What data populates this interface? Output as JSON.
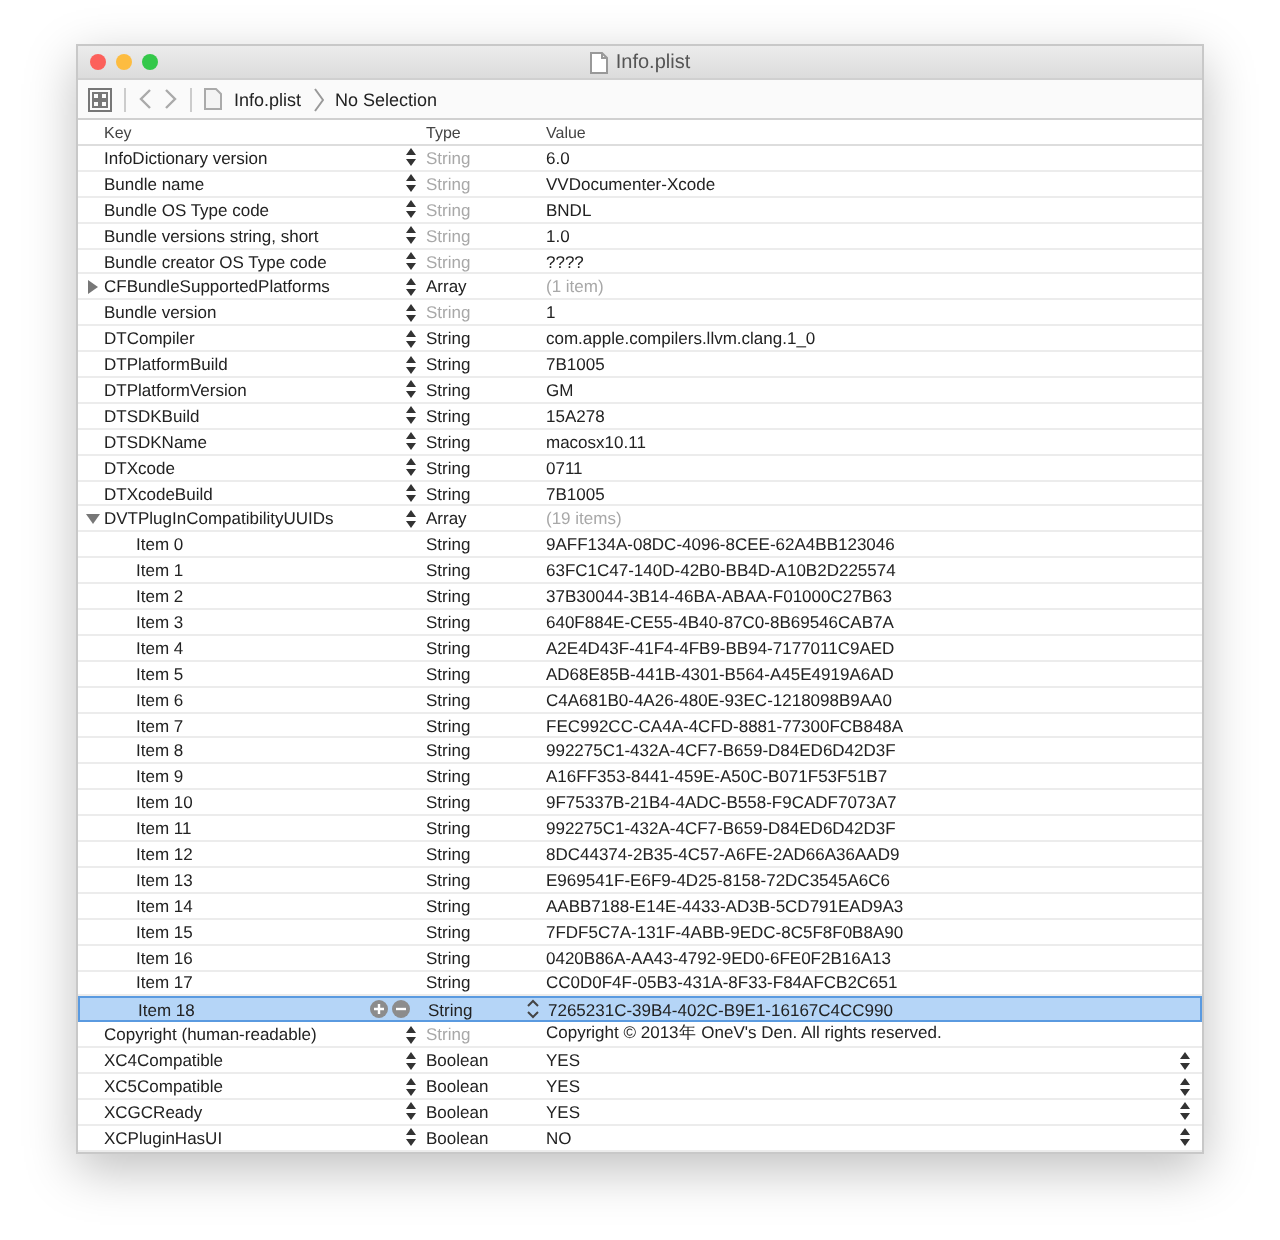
{
  "window": {
    "title": "Info.plist"
  },
  "breadcrumb": [
    "Info.plist",
    "No Selection"
  ],
  "columns": [
    "Key",
    "Type",
    "Value"
  ],
  "rows": [
    {
      "key": "InfoDictionary version",
      "type": "String",
      "type_dimmed": true,
      "value": "6.0",
      "kind": "text",
      "selected": false
    },
    {
      "key": "Bundle name",
      "type": "String",
      "type_dimmed": true,
      "value": "VVDocumenter-Xcode",
      "kind": "text",
      "selected": false
    },
    {
      "key": "Bundle OS Type code",
      "type": "String",
      "type_dimmed": true,
      "value": "BNDL",
      "kind": "text",
      "selected": false
    },
    {
      "key": "Bundle versions string, short",
      "type": "String",
      "type_dimmed": true,
      "value": "1.0",
      "kind": "text",
      "selected": false
    },
    {
      "key": "Bundle creator OS Type code",
      "type": "String",
      "type_dimmed": true,
      "value": "????",
      "kind": "text",
      "selected": false
    },
    {
      "key": "CFBundleSupportedPlatforms",
      "type": "Array",
      "type_dimmed": false,
      "value": "(1 item)",
      "kind": "array",
      "expanded": false,
      "selected": false
    },
    {
      "key": "Bundle version",
      "type": "String",
      "type_dimmed": true,
      "value": "1",
      "kind": "text",
      "selected": false
    },
    {
      "key": "DTCompiler",
      "type": "String",
      "type_dimmed": false,
      "value": "com.apple.compilers.llvm.clang.1_0",
      "kind": "text",
      "selected": false
    },
    {
      "key": "DTPlatformBuild",
      "type": "String",
      "type_dimmed": false,
      "value": "7B1005",
      "kind": "text",
      "selected": false
    },
    {
      "key": "DTPlatformVersion",
      "type": "String",
      "type_dimmed": false,
      "value": "GM",
      "kind": "text",
      "selected": false
    },
    {
      "key": "DTSDKBuild",
      "type": "String",
      "type_dimmed": false,
      "value": "15A278",
      "kind": "text",
      "selected": false
    },
    {
      "key": "DTSDKName",
      "type": "String",
      "type_dimmed": false,
      "value": "macosx10.11",
      "kind": "text",
      "selected": false
    },
    {
      "key": "DTXcode",
      "type": "String",
      "type_dimmed": false,
      "value": "0711",
      "kind": "text",
      "selected": false
    },
    {
      "key": "DTXcodeBuild",
      "type": "String",
      "type_dimmed": false,
      "value": "7B1005",
      "kind": "text",
      "selected": false
    },
    {
      "key": "DVTPlugInCompatibilityUUIDs",
      "type": "Array",
      "type_dimmed": false,
      "value": "(19 items)",
      "kind": "array",
      "expanded": true,
      "selected": false,
      "children": [
        {
          "key": "Item 0",
          "type": "String",
          "type_dimmed": false,
          "value": "9AFF134A-08DC-4096-8CEE-62A4BB123046",
          "kind": "text",
          "selected": false
        },
        {
          "key": "Item 1",
          "type": "String",
          "type_dimmed": false,
          "value": "63FC1C47-140D-42B0-BB4D-A10B2D225574",
          "kind": "text",
          "selected": false
        },
        {
          "key": "Item 2",
          "type": "String",
          "type_dimmed": false,
          "value": "37B30044-3B14-46BA-ABAA-F01000C27B63",
          "kind": "text",
          "selected": false
        },
        {
          "key": "Item 3",
          "type": "String",
          "type_dimmed": false,
          "value": "640F884E-CE55-4B40-87C0-8B69546CAB7A",
          "kind": "text",
          "selected": false
        },
        {
          "key": "Item 4",
          "type": "String",
          "type_dimmed": false,
          "value": "A2E4D43F-41F4-4FB9-BB94-7177011C9AED",
          "kind": "text",
          "selected": false
        },
        {
          "key": "Item 5",
          "type": "String",
          "type_dimmed": false,
          "value": "AD68E85B-441B-4301-B564-A45E4919A6AD",
          "kind": "text",
          "selected": false
        },
        {
          "key": "Item 6",
          "type": "String",
          "type_dimmed": false,
          "value": "C4A681B0-4A26-480E-93EC-1218098B9AA0",
          "kind": "text",
          "selected": false
        },
        {
          "key": "Item 7",
          "type": "String",
          "type_dimmed": false,
          "value": "FEC992CC-CA4A-4CFD-8881-77300FCB848A",
          "kind": "text",
          "selected": false
        },
        {
          "key": "Item 8",
          "type": "String",
          "type_dimmed": false,
          "value": "992275C1-432A-4CF7-B659-D84ED6D42D3F",
          "kind": "text",
          "selected": false
        },
        {
          "key": "Item 9",
          "type": "String",
          "type_dimmed": false,
          "value": "A16FF353-8441-459E-A50C-B071F53F51B7",
          "kind": "text",
          "selected": false
        },
        {
          "key": "Item 10",
          "type": "String",
          "type_dimmed": false,
          "value": "9F75337B-21B4-4ADC-B558-F9CADF7073A7",
          "kind": "text",
          "selected": false
        },
        {
          "key": "Item 11",
          "type": "String",
          "type_dimmed": false,
          "value": "992275C1-432A-4CF7-B659-D84ED6D42D3F",
          "kind": "text",
          "selected": false
        },
        {
          "key": "Item 12",
          "type": "String",
          "type_dimmed": false,
          "value": "8DC44374-2B35-4C57-A6FE-2AD66A36AAD9",
          "kind": "text",
          "selected": false
        },
        {
          "key": "Item 13",
          "type": "String",
          "type_dimmed": false,
          "value": "E969541F-E6F9-4D25-8158-72DC3545A6C6",
          "kind": "text",
          "selected": false
        },
        {
          "key": "Item 14",
          "type": "String",
          "type_dimmed": false,
          "value": "AABB7188-E14E-4433-AD3B-5CD791EAD9A3",
          "kind": "text",
          "selected": false
        },
        {
          "key": "Item 15",
          "type": "String",
          "type_dimmed": false,
          "value": "7FDF5C7A-131F-4ABB-9EDC-8C5F8F0B8A90",
          "kind": "text",
          "selected": false
        },
        {
          "key": "Item 16",
          "type": "String",
          "type_dimmed": false,
          "value": "0420B86A-AA43-4792-9ED0-6FE0F2B16A13",
          "kind": "text",
          "selected": false
        },
        {
          "key": "Item 17",
          "type": "String",
          "type_dimmed": false,
          "value": "CC0D0F4F-05B3-431A-8F33-F84AFCB2C651",
          "kind": "text",
          "selected": false
        },
        {
          "key": "Item 18",
          "type": "String",
          "type_dimmed": false,
          "value": "7265231C-39B4-402C-B9E1-16167C4CC990",
          "kind": "text",
          "selected": true
        }
      ]
    },
    {
      "key": "Copyright (human-readable)",
      "type": "String",
      "type_dimmed": true,
      "value": "Copyright © 2013年 OneV's Den. All rights reserved.",
      "kind": "text",
      "selected": false
    },
    {
      "key": "XC4Compatible",
      "type": "Boolean",
      "type_dimmed": false,
      "value": "YES",
      "kind": "boolean",
      "selected": false
    },
    {
      "key": "XC5Compatible",
      "type": "Boolean",
      "type_dimmed": false,
      "value": "YES",
      "kind": "boolean",
      "selected": false
    },
    {
      "key": "XCGCReady",
      "type": "Boolean",
      "type_dimmed": false,
      "value": "YES",
      "kind": "boolean",
      "selected": false
    },
    {
      "key": "XCPluginHasUI",
      "type": "Boolean",
      "type_dimmed": false,
      "value": "NO",
      "kind": "boolean",
      "selected": false
    }
  ]
}
